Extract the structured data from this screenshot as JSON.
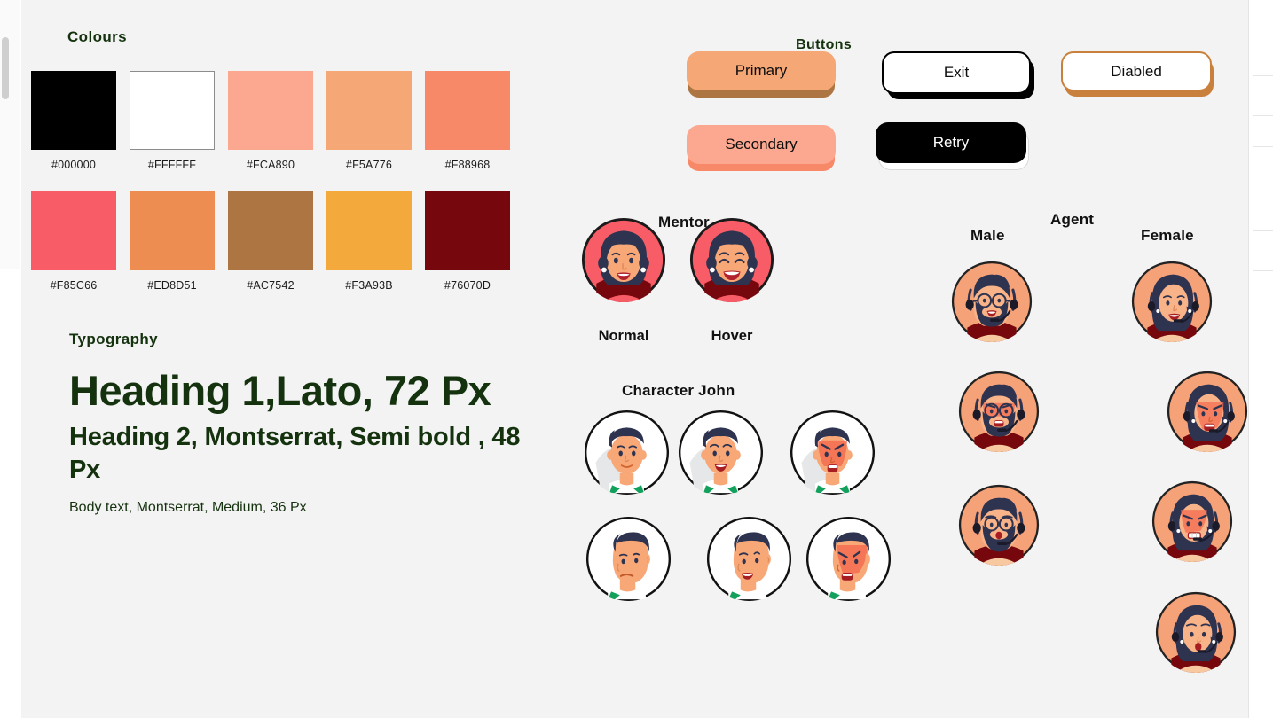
{
  "canvas": {
    "background": "#F3F3F3",
    "page_background": "#FFFFFF"
  },
  "theme": {
    "heading_green": "#15320F",
    "label_black": "#111111"
  },
  "colours": {
    "title": "Colours",
    "swatches": [
      {
        "hex": "#000000",
        "name": "black"
      },
      {
        "hex": "#FFFFFF",
        "name": "white"
      },
      {
        "hex": "#FCA890",
        "name": "peach-light"
      },
      {
        "hex": "#F5A776",
        "name": "orange-light"
      },
      {
        "hex": "#F88968",
        "name": "coral"
      },
      {
        "hex": "#F85C66",
        "name": "red-pink"
      },
      {
        "hex": "#ED8D51",
        "name": "orange"
      },
      {
        "hex": "#AC7542",
        "name": "brown"
      },
      {
        "hex": "#F3A93B",
        "name": "amber"
      },
      {
        "hex": "#76070D",
        "name": "dark-maroon"
      }
    ]
  },
  "typography": {
    "title": "Typography",
    "h1": "Heading 1,Lato, 72 Px",
    "h2": "Heading 2, Montserrat, Semi bold , 48 Px",
    "body": "Body text, Montserrat, Medium, 36 Px"
  },
  "buttons": {
    "title": "Buttons",
    "items": [
      {
        "label": "Primary",
        "variant": "primary"
      },
      {
        "label": "Exit",
        "variant": "exit"
      },
      {
        "label": "Diabled",
        "variant": "disabled"
      },
      {
        "label": "Secondary",
        "variant": "secondary"
      },
      {
        "label": "Retry",
        "variant": "retry"
      }
    ]
  },
  "mentor": {
    "title": "Mentor",
    "states": [
      {
        "caption": "Normal",
        "expression": "smiling"
      },
      {
        "caption": "Hover",
        "expression": "laughing"
      }
    ]
  },
  "character": {
    "title": "Character John",
    "avatars": [
      {
        "expression": "neutral-front"
      },
      {
        "expression": "happy-front"
      },
      {
        "expression": "angry-front"
      },
      {
        "expression": "sad-side"
      },
      {
        "expression": "happy-side"
      },
      {
        "expression": "angry-side"
      }
    ]
  },
  "agent": {
    "title": "Agent",
    "columns": [
      {
        "label": "Male",
        "avatars": [
          {
            "expression": "happy"
          },
          {
            "expression": "talking"
          },
          {
            "expression": "surprised"
          }
        ]
      },
      {
        "label": "Female",
        "avatars": [
          {
            "expression": "happy"
          },
          {
            "expression": "angry"
          },
          {
            "expression": "gritting"
          },
          {
            "expression": "surprised"
          }
        ]
      }
    ]
  },
  "chrome": {
    "left_rail": {
      "scrollbar": "vertical-scrollbar-thumb"
    },
    "right_panel": {
      "row_offsets": [
        85,
        130,
        165,
        260,
        305
      ]
    }
  }
}
